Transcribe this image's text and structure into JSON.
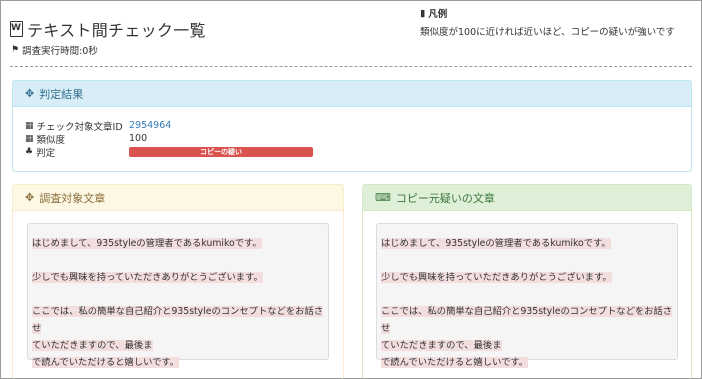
{
  "header": {
    "title": "テキスト間チェック一覧",
    "exec_time": "調査実行時間:0秒"
  },
  "legend": {
    "title": "凡例",
    "text": "類似度が100に近ければ近いほど、コピーの疑いが強いです"
  },
  "result": {
    "heading": "判定結果",
    "rows": [
      {
        "label": "チェック対象文章ID",
        "value": "2954964"
      },
      {
        "label": "類似度",
        "value": "100"
      },
      {
        "label": "判定",
        "value": "コピーの疑い"
      }
    ],
    "badge_color": "#d9534f"
  },
  "target": {
    "heading": "調査対象文章",
    "paragraphs": [
      [
        "はじめまして、935styleの管理者であるkumikoです。"
      ],
      [
        "少しでも興味を持っていただきありがとうございます。"
      ],
      [
        "ここでは、私の簡単な自己紹介と935styleのコンセプトなどをお話させ",
        "ていただきますので、最後ま",
        "で読んでいただけると嬉しいです。"
      ]
    ]
  },
  "source": {
    "heading": "コピー元疑いの文章",
    "paragraphs": [
      [
        "はじめまして、935styleの管理者であるkumikoです。"
      ],
      [
        "少しでも興味を持っていただきありがとうございます。"
      ],
      [
        "ここでは、私の簡単な自己紹介と935styleのコンセプトなどをお話させ",
        "ていただきますので、最後ま",
        "で読んでいただけると嬉しいです。"
      ]
    ]
  },
  "colors": {
    "info": "#d9edf7",
    "warning": "#fcf8e3",
    "success": "#dff0d8",
    "highlight": "#f2dede",
    "danger": "#d9534f"
  },
  "icons": [
    "word-doc-icon",
    "flag-icon",
    "book-icon",
    "crosshair-icon",
    "barcode-icon",
    "sitemap-icon",
    "keyboard-icon"
  ]
}
